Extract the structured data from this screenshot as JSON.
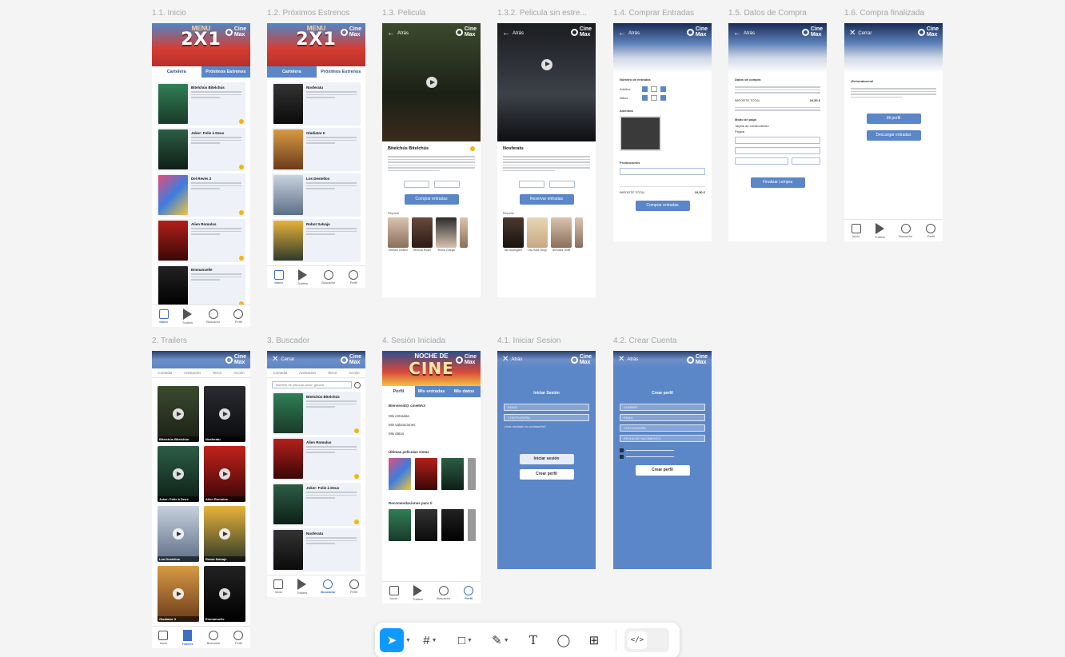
{
  "frames": {
    "f11": "1.1. Inicio",
    "f12": "1.2. Próximos Estrenos",
    "f13": "1.3. Pelicula",
    "f132": "1.3.2. Pelicula sin estre...",
    "f14": "1.4. Comprar Entradas",
    "f15": "1.5. Datos de Compra",
    "f16": "1.6. Compra finalizada",
    "f2": "2. Trailers",
    "f3": "3. Buscador",
    "f4": "4. Sesión Iniciada",
    "f41": "4.1. Iniciar Sesion",
    "f42": "4.2. Crear Cuenta"
  },
  "colors": {
    "accent": "#5b86c8",
    "star": "#f2b70c",
    "figma_blue": "#0d99ff"
  },
  "header": {
    "menu_small": "MENU",
    "menu_big": "2X1",
    "logo_line1": "Cine",
    "logo_line2": "Max",
    "back": "Atrás",
    "close": "Cerrar",
    "cine_big": "CINE",
    "cine_small": "NOCHE DE"
  },
  "tabs_home": {
    "cartelera": "Cartelera",
    "proximos": "Próximos Estrenos"
  },
  "nav": {
    "inicio": "Inicio",
    "trailers": "Trailers",
    "buscador": "Buscador",
    "perfil": "Perfil"
  },
  "cartelera_cards": [
    {
      "title": "Bitelchús Bitelchús"
    },
    {
      "title": "Joker: Folie à Deux"
    },
    {
      "title": "Del Revés 2"
    },
    {
      "title": "Alien Romulus"
    },
    {
      "title": "Emmanuelle"
    }
  ],
  "proximos_cards": [
    {
      "title": "Nosferatu"
    },
    {
      "title": "Gladiator II"
    },
    {
      "title": "Los Destellos"
    },
    {
      "title": "Robot Salvaje"
    }
  ],
  "pelicula": {
    "title": "Bitelchús Bitelchús",
    "buy": "Comprar entradas",
    "reparto": "Reparto",
    "cast": [
      "Michael Keaton",
      "Winona Ryder",
      "Jenna Ortega",
      "Catherine O'Hara"
    ]
  },
  "pelicula2": {
    "title": "Nosferatu",
    "reserve": "Reservar entradas",
    "reparto": "Reparto",
    "cast": [
      "Bill Skarsgård",
      "Lily-Rose Depp",
      "Nicholas Hoult",
      "Willem Dafoe"
    ]
  },
  "comprar": {
    "num_entradas": "Número de entradas",
    "adultos": "Adultos",
    "ninos": "Niños",
    "asientos": "Asientos",
    "promociones": "Promociones",
    "importe_total": "IMPORTE TOTAL",
    "importe_value": "19,50 €",
    "buy": "Comprar entradas"
  },
  "datos": {
    "datos_compra": "Datos de compra",
    "modo_pago": "Modo de pago",
    "pago_tarjeta": "Tarjeta de crédito/débito",
    "pago_paypal": "Paypal",
    "importe_total": "IMPORTE TOTAL",
    "importe_value": "19,50 €",
    "finalizar": "Finalizar compra"
  },
  "finalizada": {
    "title": "¡Enhorabuena!",
    "mi_perfil": "Mi perfil",
    "descargar": "Descargar entradas"
  },
  "trailers_filters": [
    "Comedia",
    "Animación",
    "Terror",
    "Acción"
  ],
  "trailer_tiles": [
    "Bitelchús Bitelchús",
    "Nosferatu",
    "Joker: Folie à Deux",
    "Alien Romulus",
    "Gladiator II",
    "Robot Salvaje",
    "Los Destellos",
    "Emmanuelle"
  ],
  "buscador": {
    "placeholder": "Nombre de película, actor, género...",
    "cards": [
      "Bitelchús Bitelchús",
      "Alien Romulus",
      "Joker: Folie à Deux",
      "Nosferatu"
    ]
  },
  "sesion": {
    "tabs": [
      "Perfil",
      "Mis entradas",
      "Mis datos"
    ],
    "welcome": "Bienvenid@ cineMAX",
    "items": [
      "Mis entradas",
      "Mis valoraciones",
      "Mis datos"
    ],
    "ultimas": "Últimas películas vistas",
    "recomendaciones": "Recomendaciones para ti"
  },
  "login": {
    "title": "Iniciar Sesión",
    "email": "EMAIL",
    "password": "CONTRASEÑA",
    "forgot": "¿Has olvidado tu contraseña?",
    "login_btn": "Iniciar sesión",
    "create_btn": "Crear perfil"
  },
  "signup": {
    "title": "Crear perfil",
    "fields": [
      "NOMBRE",
      "EMAIL",
      "CONTRASEÑA",
      "FECHA DE NACIMIENTO"
    ],
    "create_btn": "Crear perfil"
  }
}
